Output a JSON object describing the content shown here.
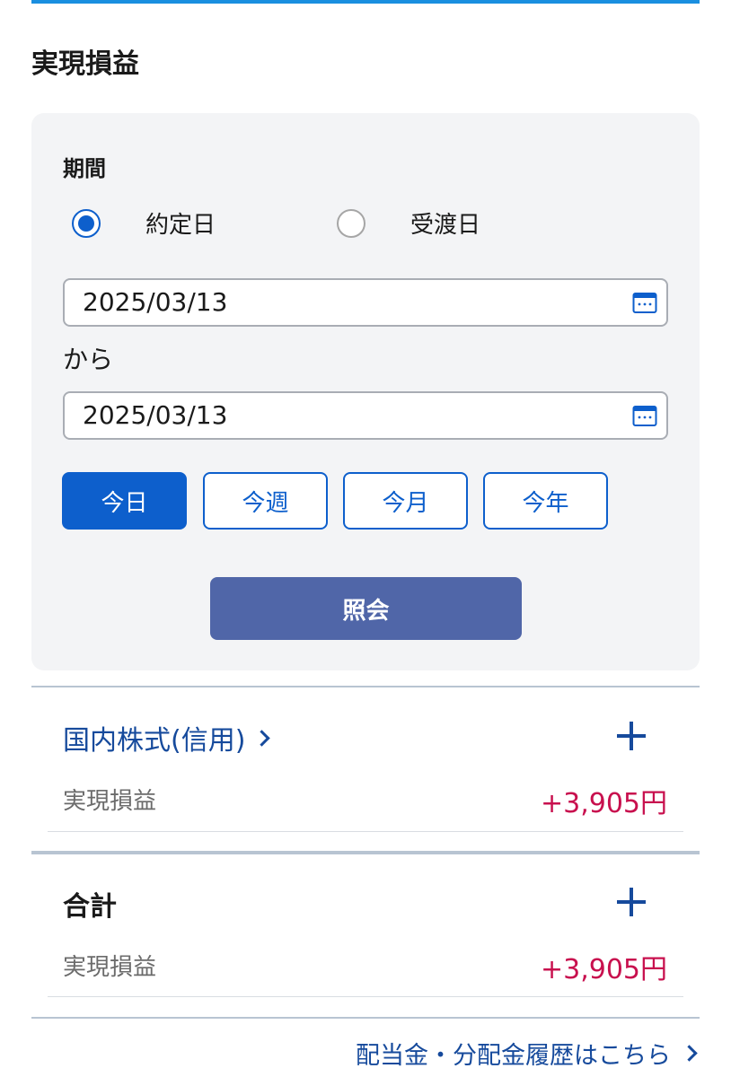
{
  "page": {
    "title": "実現損益"
  },
  "filter": {
    "period_label": "期間",
    "radio_contract_label": "約定日",
    "radio_delivery_label": "受渡日",
    "date_from": "2025/03/13",
    "kara_label": "から",
    "date_to": "2025/03/13",
    "quick_buttons": [
      "今日",
      "今週",
      "今月",
      "今年"
    ],
    "query_button_label": "照会"
  },
  "sections": [
    {
      "title": "国内株式(信用)",
      "pl_label": "実現損益",
      "pl_value": "+3,905円"
    },
    {
      "title": "合計",
      "pl_label": "実現損益",
      "pl_value": "+3,905円"
    }
  ],
  "footer": {
    "dividend_link": "配当金・分配金履歴はこちら"
  },
  "colors": {
    "accent": "#0d5fcc",
    "link": "#164a9c",
    "profit": "#c8104e",
    "query_button": "#5066a8",
    "top_bar": "#1a8fe0"
  }
}
